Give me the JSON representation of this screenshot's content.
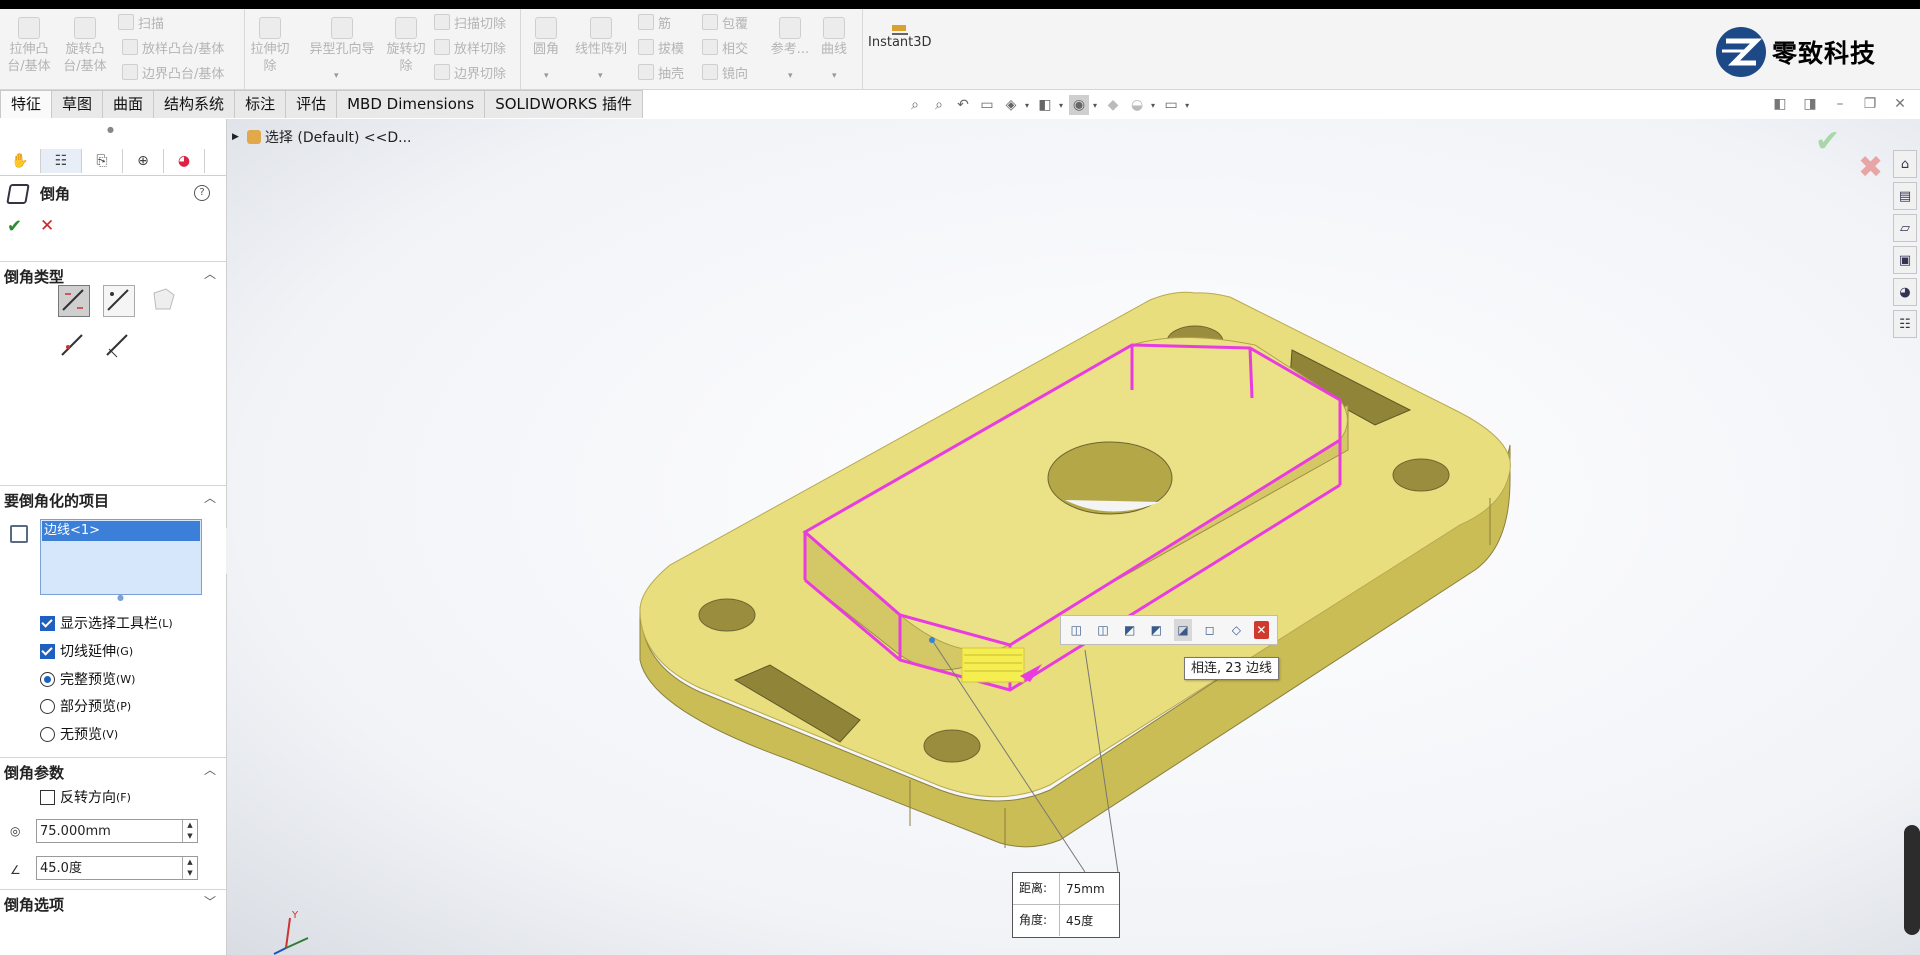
{
  "ribbon": {
    "extrude_boss": "拉伸凸台/基体",
    "revolve_boss": "旋转凸台/基体",
    "sweep": "扫描",
    "loft_boss": "放样凸台/基体",
    "boundary_boss": "边界凸台/基体",
    "extrude_cut": "拉伸切除",
    "hole_wizard": "异型孔向导",
    "revolve_cut": "旋转切除",
    "swept_cut": "扫描切除",
    "lofted_cut": "放样切除",
    "boundary_cut": "边界切除",
    "fillet": "圆角",
    "linear_pattern": "线性阵列",
    "rib": "筋",
    "draft": "拔模",
    "shell": "抽壳",
    "wrap": "包覆",
    "intersect": "相交",
    "mirror": "镜向",
    "reference": "参考...",
    "curves": "曲线",
    "instant3d": "Instant3D"
  },
  "brand": {
    "name": "零致科技",
    "color": "#1d4a86"
  },
  "tabs": [
    "特征",
    "草图",
    "曲面",
    "结构系统",
    "标注",
    "评估",
    "MBD Dimensions",
    "SOLIDWORKS 插件"
  ],
  "tree": {
    "path": "选择 (Default) <<D..."
  },
  "panel": {
    "title": "倒角",
    "help": "?",
    "ok": "✔",
    "cancel": "✕",
    "section_type": "倒角类型",
    "section_items": "要倒角化的项目",
    "list_selected": "边线<1>",
    "show_toolbar": {
      "label": "显示选择工具栏",
      "key": "(L)",
      "checked": true
    },
    "tangent": {
      "label": "切线延伸",
      "key": "(G)",
      "checked": true
    },
    "full_preview": {
      "label": "完整预览",
      "key": "(W)",
      "selected": true
    },
    "partial_preview": {
      "label": "部分预览",
      "key": "(P)",
      "selected": false
    },
    "no_preview": {
      "label": "无预览",
      "key": "(V)",
      "selected": false
    },
    "section_params": "倒角参数",
    "flip": {
      "label": "反转方向",
      "key": "(F)",
      "checked": false
    },
    "distance": "75.000mm",
    "angle": "45.0度",
    "section_options": "倒角选项"
  },
  "viewport": {
    "tooltip": "相连, 23 边线",
    "callout": {
      "distance_label": "距离:",
      "distance_value": "75mm",
      "angle_label": "角度:",
      "angle_value": "45度"
    },
    "triad_y": "Y"
  },
  "colors": {
    "part_fill": "#e8de7e",
    "selection": "#e83ce0",
    "accent": "#3b7fd8"
  }
}
